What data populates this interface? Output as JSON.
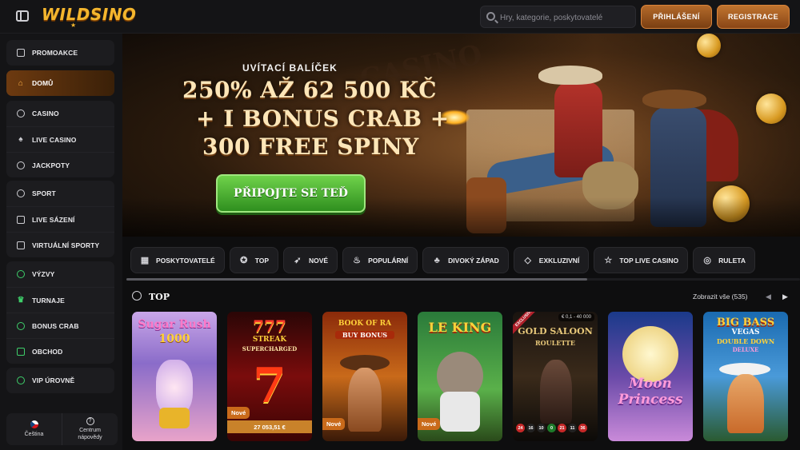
{
  "header": {
    "logo": "WILDSINO",
    "search_placeholder": "Hry, kategorie, poskytovatelé",
    "login_label": "PŘIHLÁŠENÍ",
    "register_label": "REGISTRACE"
  },
  "sidebar": {
    "promo": "PROMOAKCE",
    "home": "DOMŮ",
    "items_casino": [
      "CASINO",
      "LIVE CASINO",
      "JACKPOTY"
    ],
    "items_sport": [
      "SPORT",
      "LIVE SÁZENÍ",
      "VIRTUÁLNÍ SPORTY"
    ],
    "items_rewards": [
      "VÝZVY",
      "TURNAJE",
      "BONUS CRAB",
      "OBCHOD"
    ],
    "vip": "VIP ÚROVNĚ",
    "language": "Čeština",
    "help_line1": "Centrum",
    "help_line2": "nápovědy"
  },
  "hero": {
    "kicker": "UVÍTACÍ BALÍČEK",
    "line1": "250% AŽ 62 500 KČ",
    "line2": "+ I BONUS CRAB +",
    "line3": "300 FREE SPINY",
    "cta": "PŘIPOJTE SE TEĎ"
  },
  "categories": [
    "POSKYTOVATELÉ",
    "TOP",
    "NOVÉ",
    "POPULÁRNÍ",
    "DIVOKÝ ZÁPAD",
    "EXKLUZIVNÍ",
    "TOP LIVE CASINO",
    "RULETA"
  ],
  "section": {
    "title": "TOP",
    "view_all": "Zobrazit vše (535)"
  },
  "games": {
    "g1_title_a": "Sugar Rush",
    "g1_title_b": "1000",
    "g2_title_a": "777",
    "g2_title_b": "STREAK",
    "g2_title_c": "SUPERCHARGED",
    "g2_badge": "Nové",
    "g2_jackpot": "27 053,51 €",
    "g3_title_a": "BOOK OF RA",
    "g3_title_b": "BUY BONUS",
    "g3_badge": "Nové",
    "g4_title": "LE KING",
    "g4_badge": "Nové",
    "g5_exclusive": "EXCLUSIVE",
    "g5_limit": "€ 0,1 - 40 000",
    "g5_title_a": "GOLD SALOON",
    "g5_title_b": "ROULETTE",
    "g5_numbers": [
      "24",
      "16",
      "10",
      "0",
      "21",
      "11",
      "36"
    ],
    "g6_title_a": "Moon",
    "g6_title_b": "Princess",
    "g7_title_a": "BIG BASS",
    "g7_title_b": "VEGAS",
    "g7_title_c": "DOUBLE DOWN",
    "g7_title_d": "DELUXE"
  },
  "colors": {
    "accent_orange": "#c0742f",
    "active_nav": "#6d3a10",
    "cta_green": "#4cb83a",
    "rewards_icon_green": "#3ecf6a"
  }
}
